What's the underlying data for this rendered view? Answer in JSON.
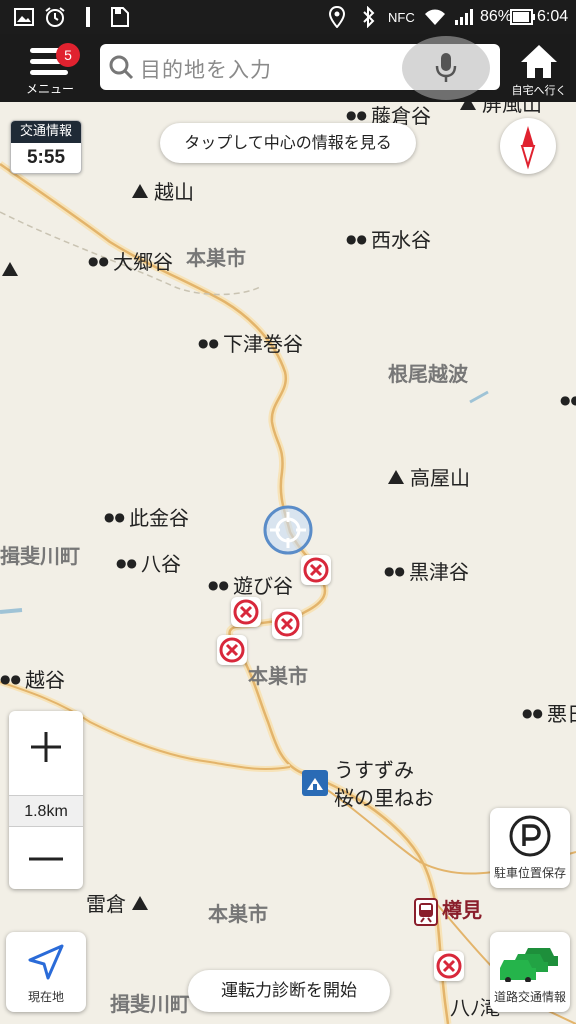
{
  "status_bar": {
    "nfc": "NFC",
    "battery": "86%",
    "time": "6:04"
  },
  "header": {
    "menu_badge": "5",
    "menu_label": "メニュー",
    "search_placeholder": "目的地を入力",
    "home_label": "自宅へ行く"
  },
  "map": {
    "traffic_info_title": "交通情報",
    "traffic_info_time": "5:55",
    "center_info_button": "タップして中心の情報を見る",
    "places": {
      "fujikuradani": "藤倉谷",
      "byoubuzan_partial": "屏風山",
      "koshiyama": "越山",
      "nishimizudani": "西水谷",
      "ookyoudani": "大郷谷",
      "shimotsumakidani": "下津巻谷",
      "takayayama": "高屋山",
      "kogane_dani": "此金谷",
      "hachiya": "八谷",
      "asobidani": "遊び谷",
      "kurotsudani": "黒津谷",
      "koshidani": "越谷",
      "akuhi_partial": "悪日",
      "raikura": "雷倉",
      "usuzumi_1": "うすずみ",
      "usuzumi_2": "桜の里ねお",
      "tarumi": "樽見",
      "hachiyama_partial": "八ﾉ滝"
    },
    "areas": {
      "motosu_1": "本巣市",
      "motosu_2": "本巣市",
      "motosu_3": "本巣市",
      "neo_koshinami": "根尾越波",
      "ibigawa_1": "揖斐川町",
      "ibigawa_2": "揖斐川町"
    },
    "zoom_scale": "1.8km",
    "parking_label": "駐車位置保存",
    "current_location_label": "現在地",
    "road_traffic_label": "道路交通情報",
    "diagnosis_button": "運転力診断を開始"
  },
  "colors": {
    "header_bg": "#1b1b1b",
    "map_bg": "#f2efe6",
    "road": "#e3b46b",
    "badge": "#e0222f",
    "noentry_red": "#d8283b"
  }
}
